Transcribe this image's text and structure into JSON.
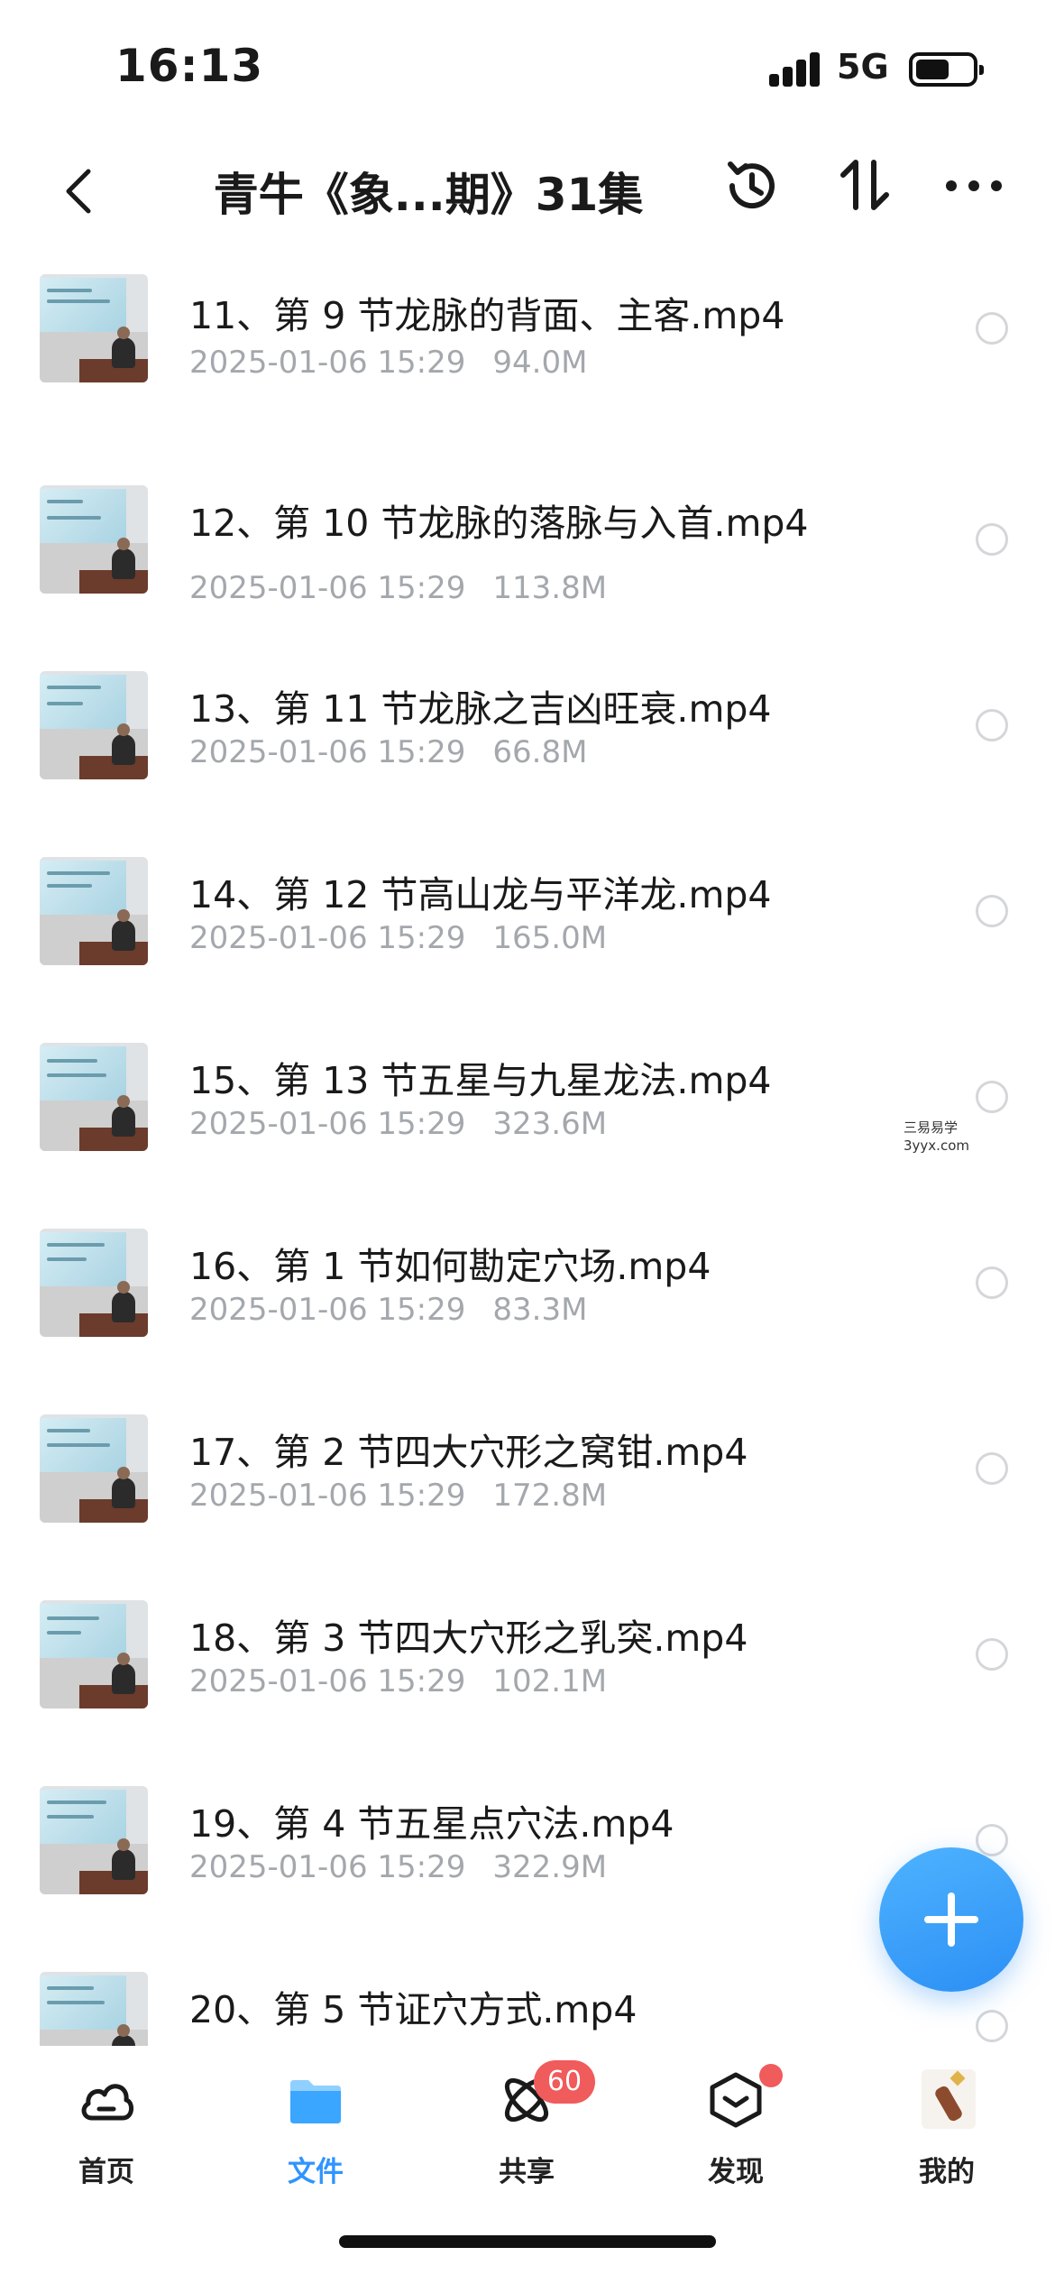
{
  "status_bar": {
    "time": "16:13",
    "network": "5G"
  },
  "header": {
    "title": "青牛《象...期》31集"
  },
  "files": [
    {
      "name": "11、第 9 节龙脉的背面、主客.mp4",
      "date": "2025-01-06 15:29",
      "size": "94.0M"
    },
    {
      "name": "12、第 10 节龙脉的落脉与入首.mp4",
      "date": "2025-01-06 15:29",
      "size": "113.8M"
    },
    {
      "name": "13、第 11 节龙脉之吉凶旺衰.mp4",
      "date": "2025-01-06 15:29",
      "size": "66.8M"
    },
    {
      "name": "14、第 12 节高山龙与平洋龙.mp4",
      "date": "2025-01-06 15:29",
      "size": "165.0M"
    },
    {
      "name": "15、第 13 节五星与九星龙法.mp4",
      "date": "2025-01-06 15:29",
      "size": "323.6M"
    },
    {
      "name": "16、第 1 节如何勘定穴场.mp4",
      "date": "2025-01-06 15:29",
      "size": "83.3M"
    },
    {
      "name": "17、第 2 节四大穴形之窝钳.mp4",
      "date": "2025-01-06 15:29",
      "size": "172.8M"
    },
    {
      "name": "18、第 3 节四大穴形之乳突.mp4",
      "date": "2025-01-06 15:29",
      "size": "102.1M"
    },
    {
      "name": "19、第 4 节五星点穴法.mp4",
      "date": "2025-01-06 15:29",
      "size": "322.9M"
    },
    {
      "name": "20、第 5 节证穴方式.mp4",
      "date": "",
      "size": ""
    }
  ],
  "watermark": {
    "line1": "三易易学",
    "line2": "3yyx.com"
  },
  "tabs": [
    {
      "label": "首页",
      "icon": "cloud-icon"
    },
    {
      "label": "文件",
      "icon": "folder-icon"
    },
    {
      "label": "共享",
      "icon": "share-orbit-icon",
      "badge": "60"
    },
    {
      "label": "发现",
      "icon": "discover-box-icon"
    },
    {
      "label": "我的",
      "icon": "avatar"
    }
  ],
  "colors": {
    "accent": "#2f94ff",
    "badge": "#f05b5b",
    "meta_text": "#a4a8ad"
  }
}
